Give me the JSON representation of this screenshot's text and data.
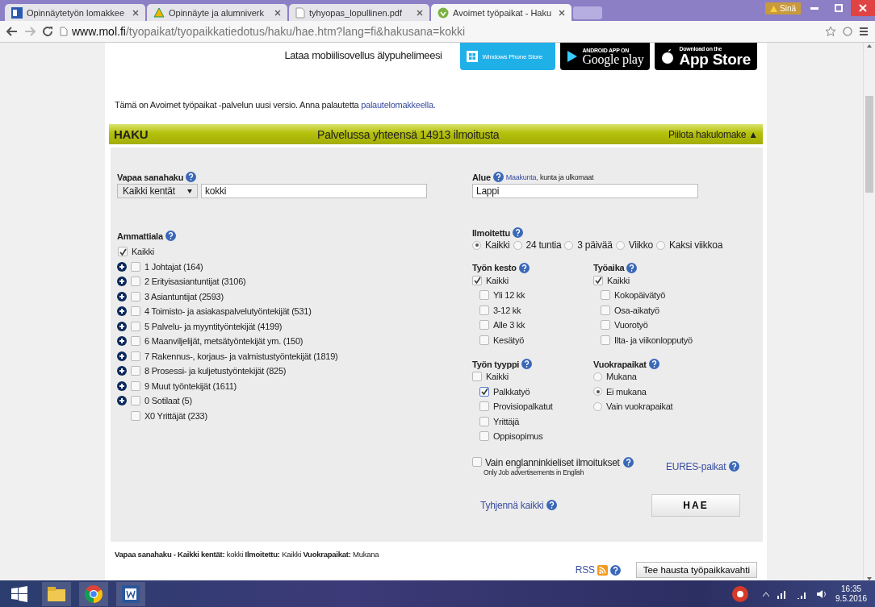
{
  "browser": {
    "tabs": [
      {
        "kind": "doc",
        "title": "Opinnäytetyön lomakkee",
        "selected": false
      },
      {
        "kind": "drive",
        "title": "Opinnäyte ja alumniverk",
        "selected": false
      },
      {
        "kind": "pdf",
        "title": "tyhyopas_lopullinen.pdf",
        "selected": false
      },
      {
        "kind": "site",
        "title": "Avoimet työpaikat - Haku",
        "selected": true
      }
    ],
    "profile": "Sinä",
    "url_host": "www.mol.fi",
    "url_path": "/tyopaikat/tyopaikkatiedotus/haku/hae.htm?lang=fi&hakusana=kokki"
  },
  "promo": {
    "text": "Lataa mobiilisovellus älypuhelimeesi",
    "badges": [
      {
        "kind": "windows",
        "label": "Windows Phone Store"
      },
      {
        "kind": "google",
        "caption": "ANDROID APP ON",
        "label": "Google play"
      },
      {
        "kind": "apple",
        "caption": "Download on the",
        "label": "App Store"
      }
    ]
  },
  "notice": {
    "text": "Tämä on Avoimet työpaikat -palvelun uusi versio. Anna palautetta",
    "link": "palautelomakkeella."
  },
  "header": {
    "title": "HAKU",
    "count": "Palvelussa yhteensä 14913 ilmoitusta",
    "toggle": "Piilota hakulomake ▲"
  },
  "form": {
    "keyword": {
      "label": "Vapaa sanahaku",
      "scope": "Kaikki kentät",
      "value": "kokki"
    },
    "area": {
      "label": "Alue",
      "link": "Maakunta,",
      "hint": "kunta ja ulkomaat",
      "value": "Lappi"
    },
    "occupation": {
      "label": "Ammattiala",
      "items": [
        {
          "kind": "all",
          "label": "Kaikki",
          "checked": true
        },
        {
          "kind": "group",
          "label": "1 Johtajat (164)",
          "checked": false,
          "expandable": true
        },
        {
          "kind": "group",
          "label": "2 Erityisasiantuntijat (3106)",
          "checked": false,
          "expandable": true
        },
        {
          "kind": "group",
          "label": "3 Asiantuntijat (2593)",
          "checked": false,
          "expandable": true
        },
        {
          "kind": "group",
          "label": "4 Toimisto- ja asiakaspalvelutyöntekijät (531)",
          "checked": false,
          "expandable": true
        },
        {
          "kind": "group",
          "label": "5 Palvelu- ja myyntityöntekijät (4199)",
          "checked": false,
          "expandable": true
        },
        {
          "kind": "group",
          "label": "6 Maanviljelijät, metsätyöntekijät ym. (150)",
          "checked": false,
          "expandable": true
        },
        {
          "kind": "group",
          "label": "7 Rakennus-, korjaus- ja valmistustyöntekijät (1819)",
          "checked": false,
          "expandable": true
        },
        {
          "kind": "group",
          "label": "8 Prosessi- ja kuljetustyöntekijät (825)",
          "checked": false,
          "expandable": true
        },
        {
          "kind": "group",
          "label": "9 Muut työntekijät (1611)",
          "checked": false,
          "expandable": true
        },
        {
          "kind": "group",
          "label": "0 Sotilaat (5)",
          "checked": false,
          "expandable": true
        },
        {
          "kind": "group",
          "label": "X0 Yrittäjät (233)",
          "checked": false,
          "expandable": false
        }
      ]
    },
    "posted": {
      "label": "Ilmoitettu",
      "options": [
        {
          "label": "Kaikki",
          "selected": true
        },
        {
          "label": "24 tuntia",
          "selected": false
        },
        {
          "label": "3 päivää",
          "selected": false
        },
        {
          "label": "Viikko",
          "selected": false
        },
        {
          "label": "Kaksi viikkoa",
          "selected": false
        }
      ]
    },
    "duration": {
      "label": "Työn kesto",
      "items": [
        {
          "kind": "all",
          "label": "Kaikki",
          "checked": true
        },
        {
          "kind": "option",
          "label": "Yli 12 kk",
          "checked": false
        },
        {
          "kind": "option",
          "label": "3-12 kk",
          "checked": false
        },
        {
          "kind": "option",
          "label": "Alle 3 kk",
          "checked": false
        },
        {
          "kind": "option",
          "label": "Kesätyö",
          "checked": false
        }
      ]
    },
    "worktime": {
      "label": "Työaika",
      "items": [
        {
          "kind": "all",
          "label": "Kaikki",
          "checked": true
        },
        {
          "kind": "option",
          "label": "Kokopäivätyö",
          "checked": false
        },
        {
          "kind": "option",
          "label": "Osa-aikatyö",
          "checked": false
        },
        {
          "kind": "option",
          "label": "Vuorotyö",
          "checked": false
        },
        {
          "kind": "option",
          "label": "Ilta- ja viikonlopputyö",
          "checked": false
        }
      ]
    },
    "jobtype": {
      "label": "Työn tyyppi",
      "items": [
        {
          "kind": "all",
          "label": "Kaikki",
          "checked": false
        },
        {
          "kind": "option",
          "label": "Palkkatyö",
          "checked": true
        },
        {
          "kind": "option",
          "label": "Provisiopalkatut",
          "checked": false
        },
        {
          "kind": "option",
          "label": "Yrittäjä",
          "checked": false
        },
        {
          "kind": "option",
          "label": "Oppisopimus",
          "checked": false
        }
      ]
    },
    "rental": {
      "label": "Vuokrapaikat",
      "options": [
        {
          "label": "Mukana",
          "selected": false
        },
        {
          "label": "Ei mukana",
          "selected": true
        },
        {
          "label": "Vain vuokrapaikat",
          "selected": false
        }
      ]
    },
    "english": {
      "label": "Vain englanninkieliset ilmoitukset",
      "checked": false,
      "note": "Only Job advertisements in English"
    },
    "eures": "EURES-paikat",
    "clear": "Tyhjennä kaikki",
    "submit": "HAE"
  },
  "summary": "**Vapaa sanahaku - Kaikki kentät:** kokki **Ilmoitettu:** Kaikki **Vuokrapaikat:** Mukana",
  "rss": "RSS",
  "alert_button": "Tee hausta työpaikkavahti",
  "taskbar": {
    "time": "16:35",
    "date": "9.5.2016"
  }
}
